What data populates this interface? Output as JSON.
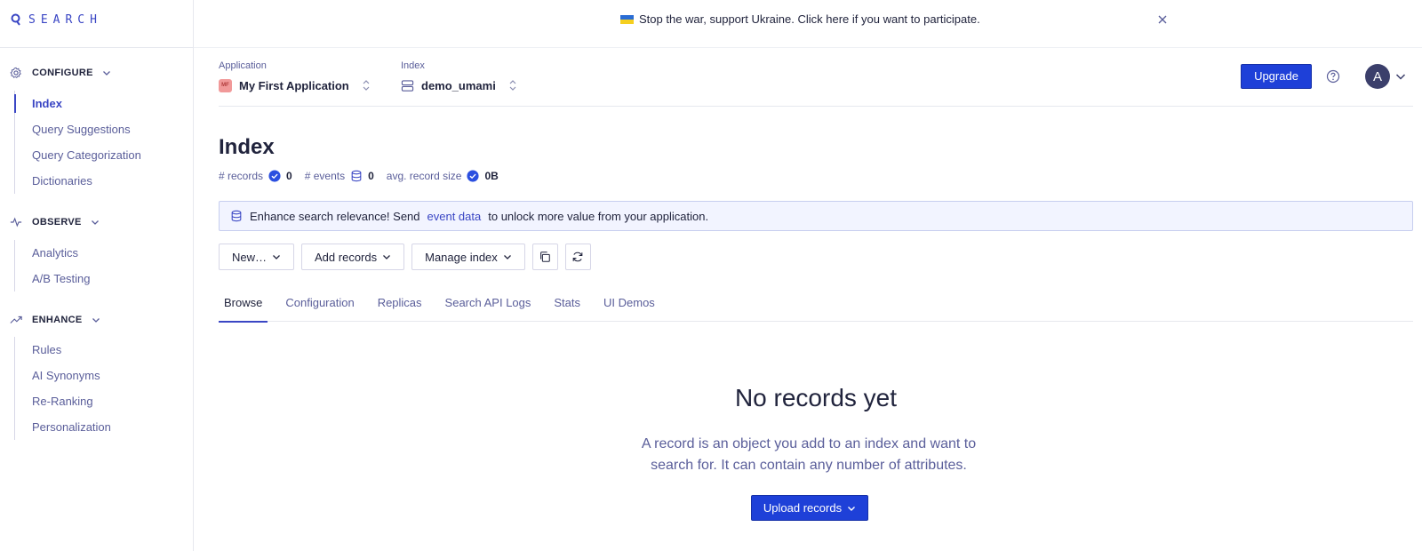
{
  "logo": {
    "text": "SEARCH"
  },
  "banner": {
    "message": "Stop the war, support Ukraine. Click here if you want to participate."
  },
  "sidebar": {
    "sections": [
      {
        "label": "CONFIGURE",
        "icon": "gear-icon",
        "items": [
          "Index",
          "Query Suggestions",
          "Query Categorization",
          "Dictionaries"
        ]
      },
      {
        "label": "OBSERVE",
        "icon": "activity-icon",
        "items": [
          "Analytics",
          "A/B Testing"
        ]
      },
      {
        "label": "ENHANCE",
        "icon": "trend-up-icon",
        "items": [
          "Rules",
          "AI Synonyms",
          "Re-Ranking",
          "Personalization"
        ]
      }
    ],
    "active_item": "Index"
  },
  "topbar": {
    "application_label": "Application",
    "application_badge": "MF",
    "application_name": "My First Application",
    "index_label": "Index",
    "index_name": "demo_umami",
    "upgrade_label": "Upgrade",
    "avatar_initial": "A"
  },
  "main": {
    "title": "Index",
    "stats": [
      {
        "label": "# records",
        "value": "0",
        "icon": "check-circle-icon"
      },
      {
        "label": "# events",
        "value": "0",
        "icon": "database-icon"
      },
      {
        "label": "avg. record size",
        "value": "0B",
        "icon": "check-circle-icon"
      }
    ],
    "info": {
      "prefix": "Enhance search relevance! Send",
      "link": "event data",
      "suffix": "to unlock more value from your application."
    },
    "toolbar": {
      "new_label": "New…",
      "add_records_label": "Add records",
      "manage_index_label": "Manage index"
    },
    "tabs": [
      "Browse",
      "Configuration",
      "Replicas",
      "Search API Logs",
      "Stats",
      "UI Demos"
    ],
    "active_tab": "Browse",
    "empty": {
      "title": "No records yet",
      "description": "A record is an object you add to an index and want to search for. It can contain any number of attributes.",
      "upload_label": "Upload records"
    }
  },
  "colors": {
    "accent": "#3a46c4",
    "primary_button": "#1e40d8",
    "text": "#21243d",
    "muted": "#5a5e9a"
  }
}
